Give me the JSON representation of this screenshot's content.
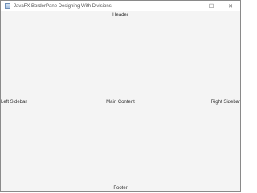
{
  "window": {
    "title": "JavaFX BorderPane Designing With Divisions",
    "controls": {
      "minimize": "—",
      "maximize": "☐",
      "close": "✕"
    }
  },
  "regions": {
    "header": "Header",
    "left_sidebar": "Left Sidebar",
    "main_content": "Main Content",
    "right_sidebar": "Right Sidebar",
    "footer": "Footer"
  }
}
